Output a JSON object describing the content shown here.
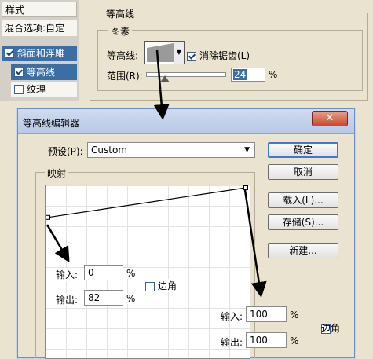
{
  "styles_panel": {
    "header": "样式",
    "items": [
      {
        "label": "混合选项:自定",
        "checked": null
      },
      {
        "label": "斜面和浮雕",
        "checked": true
      },
      {
        "label": "等高线",
        "checked": true
      },
      {
        "label": "纹理",
        "checked": false
      }
    ]
  },
  "contour_panel": {
    "title": "等高线",
    "group_title": "图素",
    "contour_label": "等高线:",
    "anti_alias_label": "消除锯齿(L)",
    "anti_alias_checked": true,
    "range_label": "范围(R):",
    "range_value": "24",
    "range_unit": "%",
    "range_fraction": 0.24
  },
  "dialog": {
    "title": "等高线编辑器",
    "close_glyph": "✕",
    "preset_label": "预设(P):",
    "preset_value": "Custom",
    "mapping_title": "映射",
    "buttons": {
      "ok": "确定",
      "cancel": "取消",
      "load": "载入(L)...",
      "save": "存储(S)...",
      "new": "新建..."
    },
    "point_left": {
      "input_label": "输入:",
      "input": "0",
      "output_label": "输出:",
      "output": "82",
      "unit": "%",
      "corner_label": "边角",
      "corner_checked": false
    },
    "point_right": {
      "input_label": "输入:",
      "input": "100",
      "output_label": "输出:",
      "output": "100",
      "unit": "%",
      "corner_label": "边角",
      "corner_checked": false
    },
    "curve": {
      "points": [
        [
          0,
          82
        ],
        [
          100,
          100
        ]
      ]
    }
  },
  "colors": {
    "selection": "#3a6ea5",
    "annotation_arrow": "#000000"
  }
}
